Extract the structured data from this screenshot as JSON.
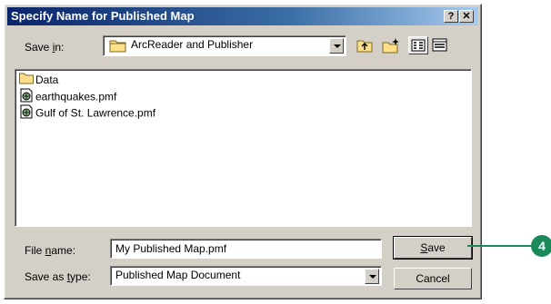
{
  "dialog": {
    "title": "Specify Name for Published Map",
    "help_glyph": "?",
    "close_glyph": "✕"
  },
  "save_in": {
    "label_pre": "Save ",
    "label_accel": "i",
    "label_post": "n:",
    "value": "ArcReader and Publisher"
  },
  "toolbar": {
    "icons": [
      "up-one-level-icon",
      "create-new-folder-icon",
      "list-view-icon",
      "details-view-icon"
    ]
  },
  "files": [
    {
      "name": "Data",
      "icon": "folder-icon"
    },
    {
      "name": "earthquakes.pmf",
      "icon": "published-map-file-icon"
    },
    {
      "name": "Gulf of St. Lawrence.pmf",
      "icon": "published-map-file-icon"
    }
  ],
  "file_name": {
    "label_pre": "File ",
    "label_accel": "n",
    "label_post": "ame:",
    "value": "My Published Map.pmf"
  },
  "save_as_type": {
    "label_pre": "Save as ",
    "label_accel": "t",
    "label_post": "ype:",
    "value": "Published Map Document"
  },
  "buttons": {
    "save_accel": "S",
    "save_rest": "ave",
    "cancel": "Cancel"
  },
  "callout": {
    "step": "4"
  },
  "colors": {
    "title_start": "#0a246a",
    "title_end": "#a6caf0",
    "face": "#d4d0c8",
    "callout": "#1a8a5a"
  }
}
